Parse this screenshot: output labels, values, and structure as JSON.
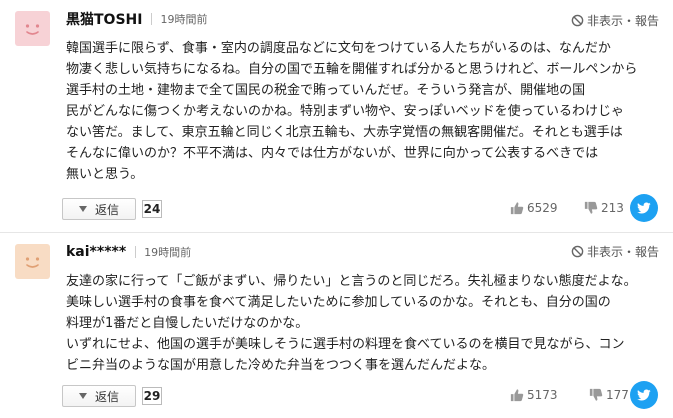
{
  "comments": [
    {
      "username": "黒猫TOSHI",
      "timestamp": "19時間前",
      "report_label": "非表示・報告",
      "body_lines": [
        "韓国選手に限らず、食事・室内の調度品などに文句をつけている人たちがいるのは、なんだか",
        "物凄く悲しい気持ちになるね。自分の国で五輪を開催すれば分かると思うけれど、ボールペンから",
        "選手村の土地・建物まで全て国民の税金で賄っていんだぜ。そういう発言が、開催地の国",
        "民がどんなに傷つくか考えないのかね。特別まずい物や、安っぽいベッドを使っているわけじゃ",
        "ない筈だ。まして、東京五輪と同じく北京五輪も、大赤字覚悟の無観客開催だ。それとも選手は",
        "そんなに偉いのか？不平不満は、内々では仕方がないが、世界に向かって公表するべきでは",
        "無いと思う。"
      ],
      "reply_label": "返信",
      "reply_count": "24",
      "likes": "6529",
      "dislikes": "213"
    },
    {
      "username": "kai*****",
      "timestamp": "19時間前",
      "report_label": "非表示・報告",
      "body_lines": [
        "友達の家に行って「ご飯がまずい、帰りたい」と言うのと同じだろ。失礼極まりない態度だよな。",
        "美味しい選手村の食事を食べて満足したいために参加しているのかな。それとも、自分の国の",
        "料理が1番だと自慢したいだけなのかな。",
        "いずれにせよ、他国の選手が美味しそうに選手村の料理を食べているのを横目で見ながら、コン",
        "ビニ弁当のような国が用意した冷めた弁当をつつく事を選んだんだよな。"
      ],
      "reply_label": "返信",
      "reply_count": "29",
      "likes": "5173",
      "dislikes": "177"
    }
  ],
  "colors": {
    "twitter": "#1da1f2",
    "avatar_pink": "#f7d2d6",
    "avatar_peach": "#f8dcc4"
  }
}
